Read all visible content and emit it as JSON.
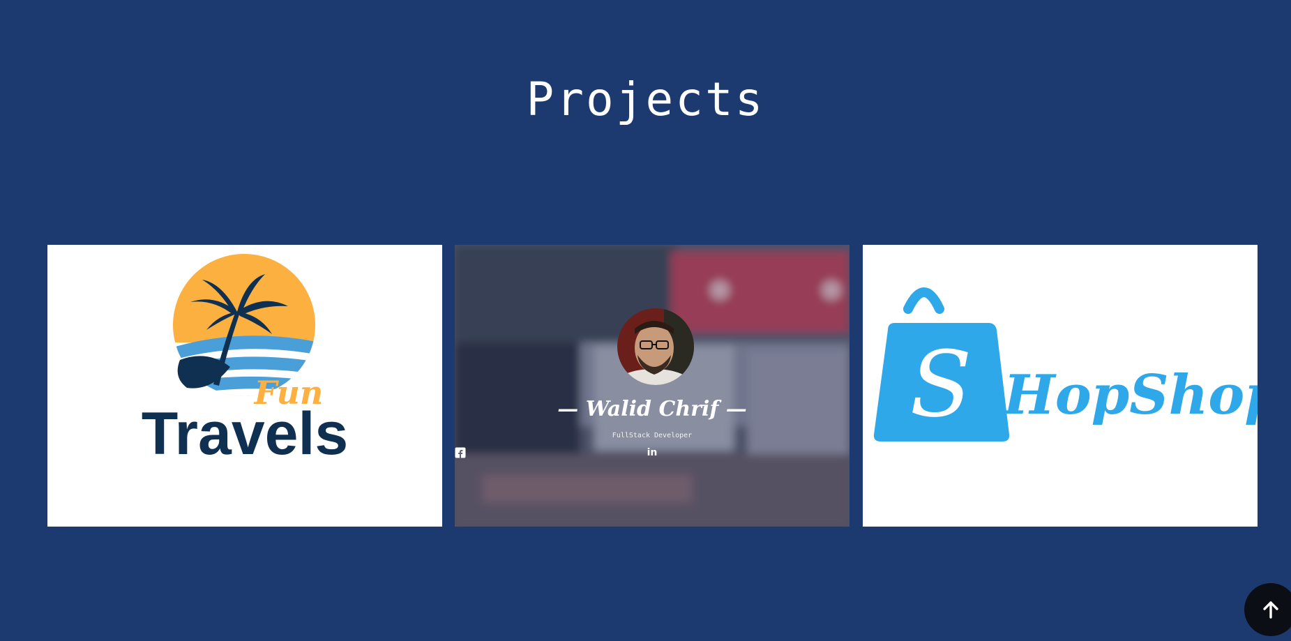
{
  "section": {
    "title": "Projects"
  },
  "projects": [
    {
      "name": "Fun Travels",
      "logo_script": "Fun",
      "logo_word": "Travels",
      "colors": {
        "sun": "#fbb040",
        "navy": "#0f3050",
        "wave": "#4a9fd8"
      },
      "icon": "palm-tree-icon"
    },
    {
      "name": "— Walid Chrif —",
      "role": "FullStack Developer",
      "social_icons": [
        "github-icon",
        "linkedin-icon",
        "facebook-icon"
      ],
      "social_glyphs": [
        "",
        "in",
        "f"
      ]
    },
    {
      "name": "HopShop",
      "logo_initial": "S",
      "logo_word": "HopShop",
      "colors": {
        "brand": "#2ea8e8"
      },
      "icon": "shopping-bag-icon"
    }
  ],
  "controls": {
    "scroll_top_icon": "arrow-up-icon"
  }
}
